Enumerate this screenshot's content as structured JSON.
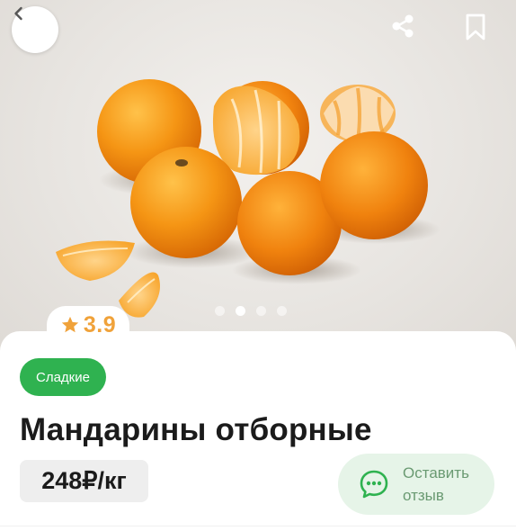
{
  "hero": {
    "back_icon": "chevron-left-icon",
    "share_icon": "share-icon",
    "bookmark_icon": "bookmark-icon",
    "carousel": {
      "count": 4,
      "active_index": 1
    }
  },
  "rating": {
    "icon": "star-icon",
    "value": "3.9",
    "color": "#f0a23a"
  },
  "product": {
    "tag": "Сладкие",
    "title": "Мандарины отборные",
    "price": "248₽/кг"
  },
  "review": {
    "icon": "chat-bubble-icon",
    "label_line1": "Оставить",
    "label_line2": "отзыв"
  },
  "colors": {
    "accent_green": "#2fb250",
    "review_bg": "#e6f4e8",
    "review_text": "#6a9a72",
    "orange": "#f08a14"
  }
}
